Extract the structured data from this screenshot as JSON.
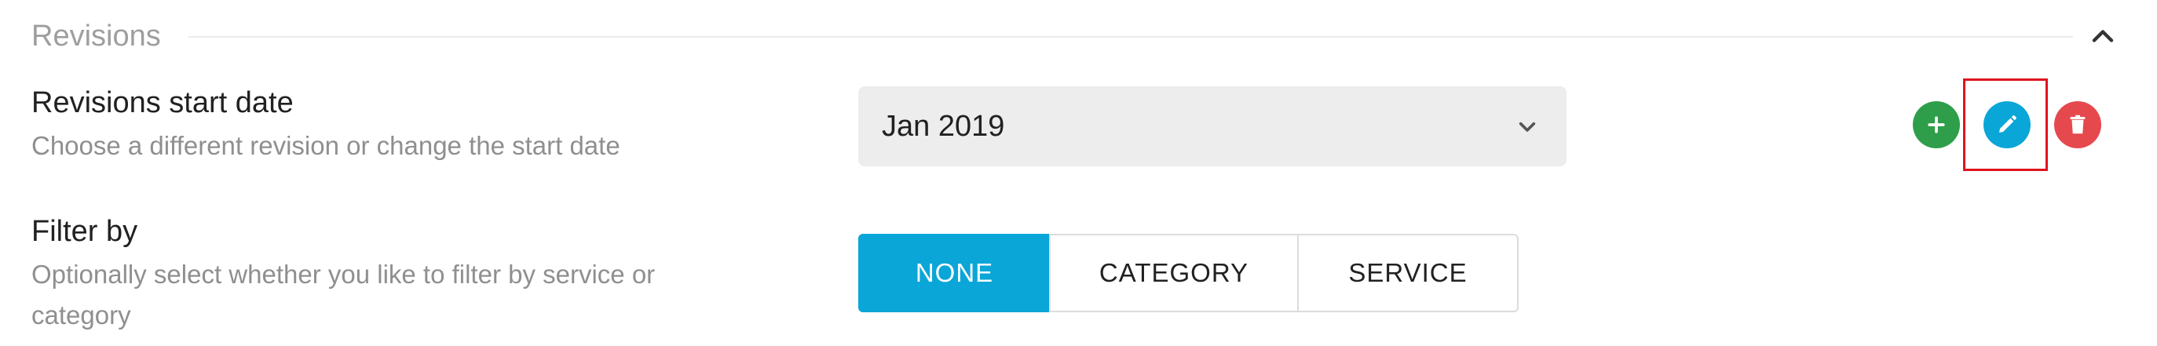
{
  "section": {
    "title": "Revisions",
    "collapse_icon": "chevron-up-icon"
  },
  "revisions_row": {
    "label": "Revisions start date",
    "description": "Choose a different revision or change the start date",
    "select": {
      "value": "Jan 2019",
      "icon": "chevron-down-icon"
    },
    "actions": {
      "add_icon": "plus-icon",
      "add_color": "#2e9e4a",
      "edit_icon": "pencil-icon",
      "edit_color": "#0aa6d8",
      "delete_icon": "trash-icon",
      "delete_color": "#e5494d",
      "highlight_color": "#e0141e"
    }
  },
  "filter_row": {
    "label": "Filter by",
    "description_line1": "Optionally select whether you like to filter by service or",
    "description_line2": "category",
    "options": [
      {
        "label": "NONE",
        "selected": true
      },
      {
        "label": "CATEGORY",
        "selected": false
      },
      {
        "label": "SERVICE",
        "selected": false
      }
    ],
    "selected_color": "#0aa6d8"
  }
}
